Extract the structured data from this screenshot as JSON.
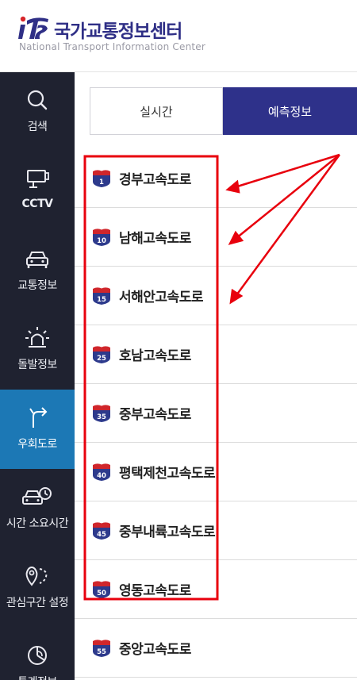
{
  "header": {
    "title_ko": "국가교통정보센터",
    "title_en": "National Transport Information Center"
  },
  "sidebar": {
    "items": [
      {
        "label": "검색",
        "icon": "search-icon"
      },
      {
        "label": "CCTV",
        "icon": "cctv-icon"
      },
      {
        "label": "교통정보",
        "icon": "car-icon"
      },
      {
        "label": "돌발정보",
        "icon": "alert-light-icon"
      },
      {
        "label": "우회도로",
        "icon": "detour-arrow-icon"
      },
      {
        "label": "시간 소요시간",
        "icon": "car-clock-icon"
      },
      {
        "label": "관심구간 설정",
        "icon": "location-pin-icon"
      },
      {
        "label": "통계정보",
        "icon": "chart-icon"
      }
    ],
    "active_index": 4
  },
  "tabs": {
    "realtime": "실시간",
    "forecast": "예측정보",
    "active": "forecast"
  },
  "roads": [
    {
      "number": "1",
      "name": "경부고속도로"
    },
    {
      "number": "10",
      "name": "남해고속도로"
    },
    {
      "number": "15",
      "name": "서해안고속도로"
    },
    {
      "number": "25",
      "name": "호남고속도로"
    },
    {
      "number": "35",
      "name": "중부고속도로"
    },
    {
      "number": "40",
      "name": "평택제천고속도로"
    },
    {
      "number": "45",
      "name": "중부내륙고속도로"
    },
    {
      "number": "50",
      "name": "영동고속도로"
    },
    {
      "number": "55",
      "name": "중앙고속도로"
    }
  ],
  "colors": {
    "brand": "#2f2f86",
    "sidebar_bg": "#1f2230",
    "sidebar_active": "#1c78b5",
    "annotation": "#e8000d"
  }
}
